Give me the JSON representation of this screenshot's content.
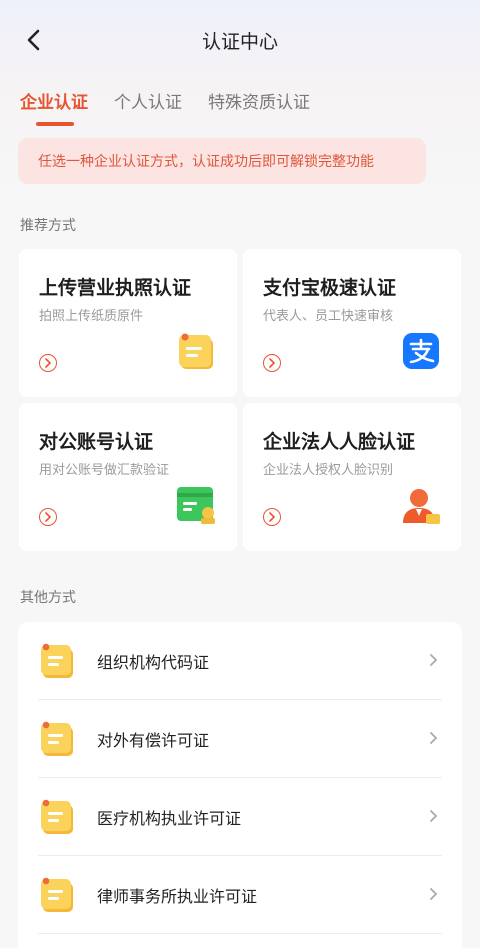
{
  "header": {
    "title": "认证中心",
    "back_icon": "chevron-left-icon"
  },
  "tabs": [
    {
      "label": "企业认证",
      "active": true
    },
    {
      "label": "个人认证",
      "active": false
    },
    {
      "label": "特殊资质认证",
      "active": false
    }
  ],
  "notice": {
    "text": "任选一种企业认证方式，认证成功后即可解锁完整功能"
  },
  "recommended": {
    "label": "推荐方式",
    "cards": [
      {
        "title": "上传营业执照认证",
        "subtitle": "拍照上传纸质原件",
        "icon": "document-note-icon"
      },
      {
        "title": "支付宝极速认证",
        "subtitle": "代表人、员工快速审核",
        "icon": "alipay-icon"
      },
      {
        "title": "对公账号认证",
        "subtitle": "用对公账号做汇款验证",
        "icon": "bank-card-icon"
      },
      {
        "title": "企业法人人脸认证",
        "subtitle": "企业法人授权人脸识别",
        "icon": "person-face-icon"
      }
    ]
  },
  "others": {
    "label": "其他方式",
    "items": [
      {
        "label": "组织机构代码证"
      },
      {
        "label": "对外有偿许可证"
      },
      {
        "label": "医疗机构执业许可证"
      },
      {
        "label": "律师事务所执业许可证"
      }
    ]
  },
  "colors": {
    "accent": "#e8542f",
    "notice_bg": "#fbe4e1",
    "icon_yellow": "#f7c545",
    "alipay_blue": "#1677ff",
    "bank_green": "#3cc65b"
  }
}
